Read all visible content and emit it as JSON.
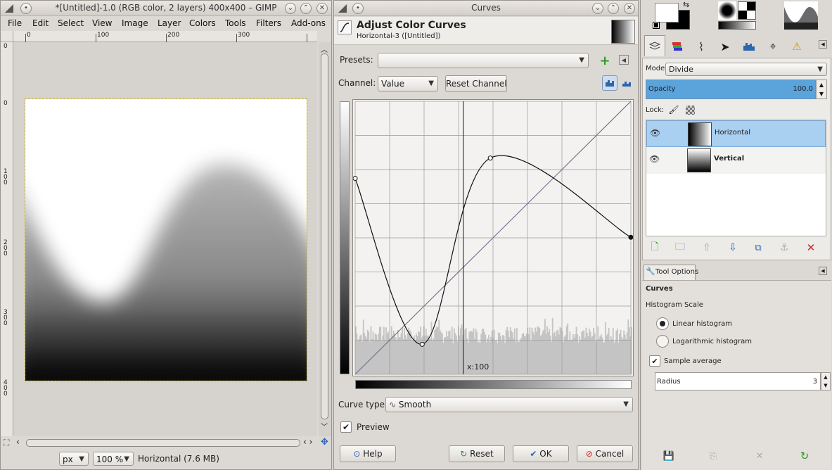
{
  "image_window": {
    "title": "*[Untitled]-1.0 (RGB color, 2 layers) 400x400 – GIMP",
    "menu": [
      "File",
      "Edit",
      "Select",
      "View",
      "Image",
      "Layer",
      "Colors",
      "Tools",
      "Filters",
      "Add-ons"
    ],
    "ruler_h_labels": [
      "0",
      "100",
      "200",
      "300"
    ],
    "ruler_v_labels": [
      "0",
      "1\n0\n0",
      "2\n0\n0",
      "3\n0\n0",
      "4\n0\n0"
    ],
    "unit": "px",
    "zoom": "100 %",
    "status": "Horizontal (7.6 MB)"
  },
  "curves_dialog": {
    "window_title": "Curves",
    "heading": "Adjust Color Curves",
    "subheading": "Horizontal-3 ([Untitled])",
    "presets_label": "Presets:",
    "presets_value": "",
    "channel_label": "Channel:",
    "channel_value": "Value",
    "reset_channel": "Reset Channel",
    "cursor_readout": "x:100",
    "curve_type_label": "Curve type:",
    "curve_type_value": "Smooth",
    "preview_label": "Preview",
    "preview_checked": true,
    "buttons": {
      "help": "Help",
      "reset": "Reset",
      "ok": "OK",
      "cancel": "Cancel"
    },
    "curve_points": [
      [
        0,
        183
      ],
      [
        62,
        28
      ],
      [
        125,
        202
      ],
      [
        255,
        128
      ]
    ]
  },
  "layers_dock": {
    "mode_label": "Mode:",
    "mode_value": "Divide",
    "opacity_label": "Opacity",
    "opacity_value": "100.0",
    "lock_label": "Lock:",
    "layers": [
      {
        "name": "Horizontal",
        "selected": true
      },
      {
        "name": "Vertical",
        "selected": false
      }
    ]
  },
  "tool_options": {
    "tab_label": "Tool Options",
    "tool_name": "Curves",
    "histogram_scale_label": "Histogram Scale",
    "linear_label": "Linear histogram",
    "log_label": "Logarithmic histogram",
    "sample_average_label": "Sample average",
    "radius_label": "Radius",
    "radius_value": "3"
  },
  "colors": {
    "selected_row": "#a9cff1",
    "opacity_bar": "#5aa3db",
    "curve_line": "#111111",
    "diagonal_line": "#6a6f8c"
  }
}
